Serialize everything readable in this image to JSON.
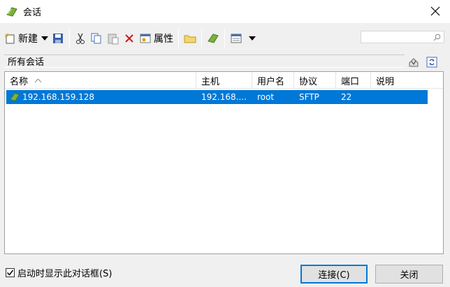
{
  "window": {
    "title": "会话"
  },
  "toolbar": {
    "new_label": "新建",
    "properties_label": "属性",
    "icons": [
      "new-session-icon",
      "dropdown-arrow-icon",
      "save-icon",
      "cut-icon",
      "copy-icon",
      "paste-icon",
      "delete-icon",
      "properties-icon",
      "folder-icon",
      "session-icon",
      "view-icon",
      "dropdown-arrow-icon"
    ]
  },
  "search": {
    "placeholder": "",
    "value": ""
  },
  "group": {
    "label": "所有会话"
  },
  "list": {
    "columns": [
      "名称",
      "主机",
      "用户名",
      "协议",
      "端口",
      "说明"
    ],
    "sort_column": "名称",
    "rows": [
      {
        "name": "192.168.159.128",
        "host": "192.168....",
        "user": "root",
        "protocol": "SFTP",
        "port": "22",
        "description": "",
        "selected": true
      }
    ]
  },
  "footer": {
    "show_on_startup_label": "启动时显示此对话框(S)",
    "show_on_startup_checked": true,
    "connect_label": "连接(C)",
    "close_label": "关闭"
  },
  "colors": {
    "selection": "#0078d7",
    "accent": "#0078d7"
  }
}
